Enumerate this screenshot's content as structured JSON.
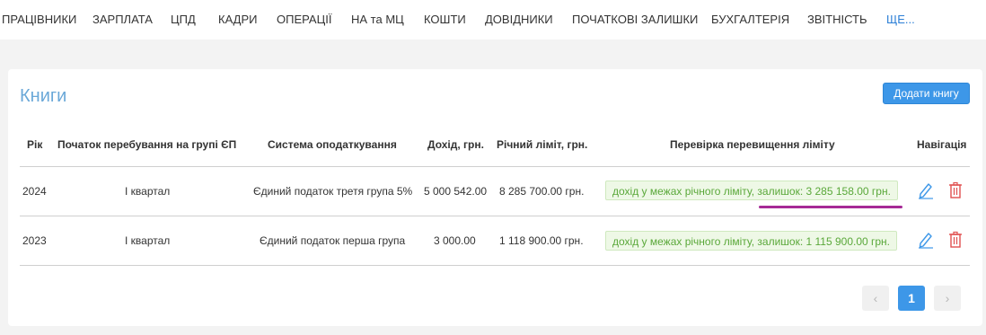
{
  "nav": {
    "items": [
      "ПРАЦІВНИКИ",
      "ЗАРПЛАТА",
      "ЦПД",
      "КАДРИ",
      "ОПЕРАЦІЇ",
      "НА та МЦ",
      "КОШТИ",
      "ДОВІДНИКИ",
      "ПОЧАТКОВІ ЗАЛИШКИ",
      "БУХГАЛТЕРІЯ",
      "ЗВІТНІСТЬ"
    ],
    "more": "ЩЕ..."
  },
  "page": {
    "title": "Книги",
    "add_button": "Додати книгу"
  },
  "table": {
    "headers": [
      "Рік",
      "Початок перебування на групі ЄП",
      "Система оподаткування",
      "Дохід, грн.",
      "Річний ліміт, грн.",
      "Перевірка перевищення ліміту",
      "Навігація"
    ],
    "rows": [
      {
        "year": "2024",
        "start": "І квартал",
        "system": "Єдиний податок третя група 5%",
        "income": "5 000 542.00",
        "limit": "8 285 700.00 грн.",
        "check": "дохід у межах річного ліміту, залишок: 3 285 158.00 грн."
      },
      {
        "year": "2023",
        "start": "І квартал",
        "system": "Єдиний податок перша група",
        "income": "3 000.00",
        "limit": "1 118 900.00 грн.",
        "check": "дохід у межах річного ліміту, залишок: 1 115 900.00 грн."
      }
    ]
  },
  "pagination": {
    "prev": "‹",
    "current": "1",
    "next": "›"
  },
  "icons": {
    "edit": "pencil-icon",
    "delete": "trash-icon"
  },
  "colors": {
    "accent": "#3d97e8",
    "title": "#6aa8d8",
    "success_text": "#5aa83a",
    "success_bg": "#eef8e6",
    "delete": "#e05050",
    "highlight": "#a62a96"
  }
}
